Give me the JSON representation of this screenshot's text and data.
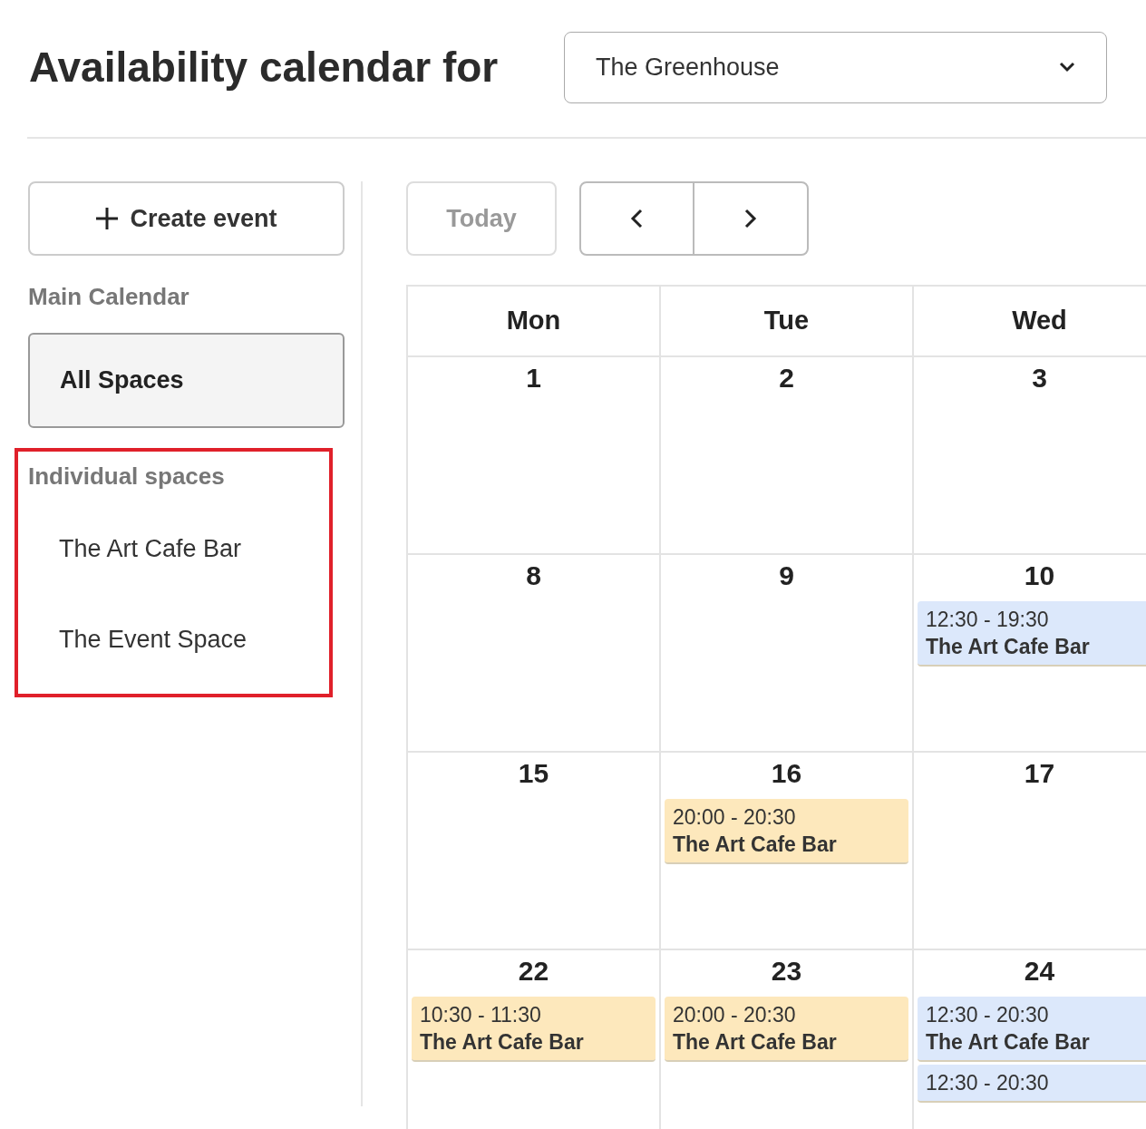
{
  "title": "Availability calendar for",
  "venue_select": {
    "value": "The Greenhouse"
  },
  "sidebar": {
    "create_button": "Create event",
    "main_heading": "Main Calendar",
    "main_items": [
      {
        "label": "All Spaces",
        "selected": true
      }
    ],
    "individual_heading": "Individual spaces",
    "individual_highlighted": true,
    "individual_items": [
      {
        "label": "The Art Cafe Bar",
        "selected": false
      },
      {
        "label": "The Event Space",
        "selected": false
      }
    ]
  },
  "toolbar": {
    "today": "Today",
    "today_disabled": true
  },
  "calendar": {
    "columns": [
      "Mon",
      "Tue",
      "Wed"
    ],
    "weeks": [
      [
        {
          "day": "1"
        },
        {
          "day": "2"
        },
        {
          "day": "3"
        }
      ],
      [
        {
          "day": "8"
        },
        {
          "day": "9"
        },
        {
          "day": "10",
          "events": [
            {
              "time": "12:30 - 19:30",
              "space": "The Art Cafe Bar",
              "color": "#dce8fb"
            }
          ]
        }
      ],
      [
        {
          "day": "15"
        },
        {
          "day": "16",
          "events": [
            {
              "time": "20:00 - 20:30",
              "space": "The Art Cafe Bar",
              "color": "#fde8bc"
            }
          ]
        },
        {
          "day": "17"
        }
      ],
      [
        {
          "day": "22",
          "events": [
            {
              "time": "10:30 - 11:30",
              "space": "The Art Cafe Bar",
              "color": "#fde8bc"
            }
          ]
        },
        {
          "day": "23",
          "events": [
            {
              "time": "20:00 - 20:30",
              "space": "The Art Cafe Bar",
              "color": "#fde8bc"
            }
          ]
        },
        {
          "day": "24",
          "events": [
            {
              "time": "12:30 - 20:30",
              "space": "The Art Cafe Bar",
              "color": "#dce8fb"
            },
            {
              "time": "12:30 - 20:30",
              "color": "#dce8fb"
            }
          ]
        }
      ]
    ]
  }
}
